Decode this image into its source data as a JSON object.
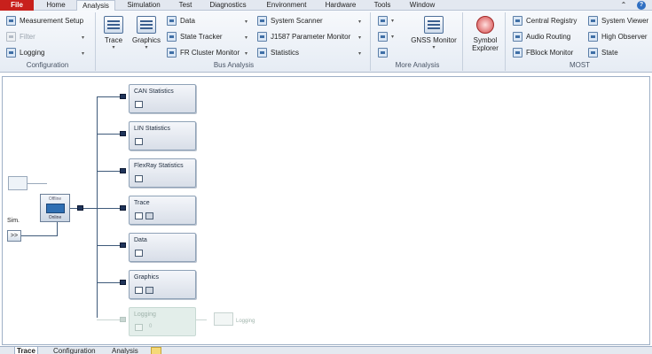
{
  "ribbon_tabs": [
    "File",
    "Home",
    "Analysis",
    "Simulation",
    "Test",
    "Diagnostics",
    "Environment",
    "Hardware",
    "Tools",
    "Window"
  ],
  "active_tab": "Analysis",
  "groups": {
    "configuration": {
      "label": "Configuration",
      "items": [
        "Measurement Setup",
        "Filter",
        "Logging"
      ]
    },
    "bus_analysis": {
      "label": "Bus Analysis",
      "trace": "Trace",
      "graphics": "Graphics",
      "items_a": [
        "Data",
        "State Tracker",
        "FR Cluster Monitor"
      ],
      "items_b": [
        "System Scanner",
        "J1587 Parameter Monitor",
        "Statistics"
      ]
    },
    "more_analysis": {
      "label": "More Analysis",
      "gnss": "GNSS Monitor"
    },
    "symbol": {
      "label": "Symbol Explorer"
    },
    "most": {
      "label": "MOST",
      "items_a": [
        "Central Registry",
        "Audio Routing",
        "FBlock Monitor"
      ],
      "items_b": [
        "System Viewer",
        "High Observer",
        "State"
      ]
    }
  },
  "canvas": {
    "sim_label": "Sim.",
    "sim_button": ">>",
    "node_title": "Offline",
    "node_subtitle": "Online",
    "blocks": [
      "CAN Statistics",
      "LIN Statistics",
      "FlexRay Statistics",
      "Trace",
      "Data",
      "Graphics",
      "Logging"
    ],
    "logging_target": "Logging",
    "logging_count": "0"
  },
  "bottom_tabs": [
    "Trace",
    "Configuration",
    "Analysis"
  ],
  "colors": {
    "file_tab": "#c8201c",
    "connector": "#20345a",
    "faded_block": "#e3eeea"
  }
}
